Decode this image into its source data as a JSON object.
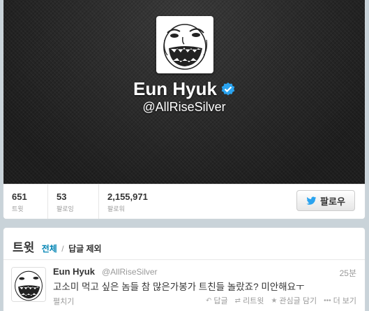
{
  "profile": {
    "display_name": "Eun Hyuk",
    "screen_name": "@AllRiseSilver",
    "verified": true,
    "avatar_text": "*.*",
    "stats": [
      {
        "value": "651",
        "label": "트윗"
      },
      {
        "value": "53",
        "label": "팔로잉"
      },
      {
        "value": "2,155,971",
        "label": "팔로워"
      }
    ],
    "follow_label": "팔로우"
  },
  "colors": {
    "link": "#0084b4",
    "verified": "#2aa3ef",
    "twitter_bird": "#2aa3ef"
  },
  "tweets_panel": {
    "title": "트윗",
    "filter_all": "전체",
    "separator": "/",
    "filter_no_replies": "답글 제외"
  },
  "tweet": {
    "name": "Eun Hyuk",
    "handle": "@AllRiseSilver",
    "time": "25분",
    "text": "고소미 먹고 싶은 놈들 참 많은가봉가 트친들 놀랐죠? 미안해요ㅜ",
    "expand": "펼치기",
    "actions": [
      {
        "icon": "reply-icon",
        "glyph": "↶",
        "label": "답글"
      },
      {
        "icon": "retweet-icon",
        "glyph": "⇄",
        "label": "리트윗"
      },
      {
        "icon": "favorite-icon",
        "glyph": "★",
        "label": "관심글 담기"
      },
      {
        "icon": "more-icon",
        "glyph": "•••",
        "label": "더 보기"
      }
    ]
  }
}
